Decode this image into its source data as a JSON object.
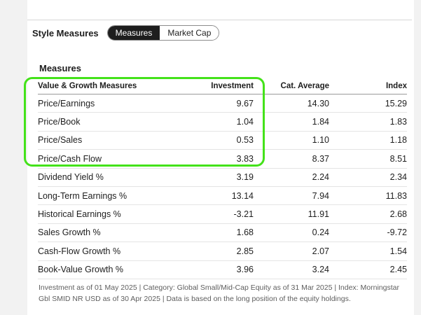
{
  "style_measures": {
    "title": "Style Measures",
    "toggle": [
      "Measures",
      "Market Cap"
    ],
    "active_toggle": "Measures"
  },
  "measures": {
    "title": "Measures",
    "columns": [
      "Value & Growth Measures",
      "Investment",
      "Cat. Average",
      "Index"
    ],
    "rows": [
      [
        "Price/Earnings",
        "9.67",
        "14.30",
        "15.29"
      ],
      [
        "Price/Book",
        "1.04",
        "1.84",
        "1.83"
      ],
      [
        "Price/Sales",
        "0.53",
        "1.10",
        "1.18"
      ],
      [
        "Price/Cash Flow",
        "3.83",
        "8.37",
        "8.51"
      ],
      [
        "Dividend Yield %",
        "3.19",
        "2.24",
        "2.34"
      ],
      [
        "Long-Term Earnings %",
        "13.14",
        "7.94",
        "11.83"
      ],
      [
        "Historical Earnings %",
        "-3.21",
        "11.91",
        "2.68"
      ],
      [
        "Sales Growth %",
        "1.68",
        "0.24",
        "-9.72"
      ],
      [
        "Cash-Flow Growth %",
        "2.85",
        "2.07",
        "1.54"
      ],
      [
        "Book-Value Growth %",
        "3.96",
        "3.24",
        "2.45"
      ]
    ]
  },
  "footnote": "Investment as of 01 May 2025 | Category: Global Small/Mid-Cap Equity as of 31 Mar 2025 | Index: Morningstar Gbl SMID NR USD as of 30 Apr 2025 | Data is based on the long position of the equity holdings.",
  "colors": {
    "highlight": "#44e21a",
    "active_toggle_bg": "#1e1e1e",
    "side_strip": "#f2f2f2"
  }
}
